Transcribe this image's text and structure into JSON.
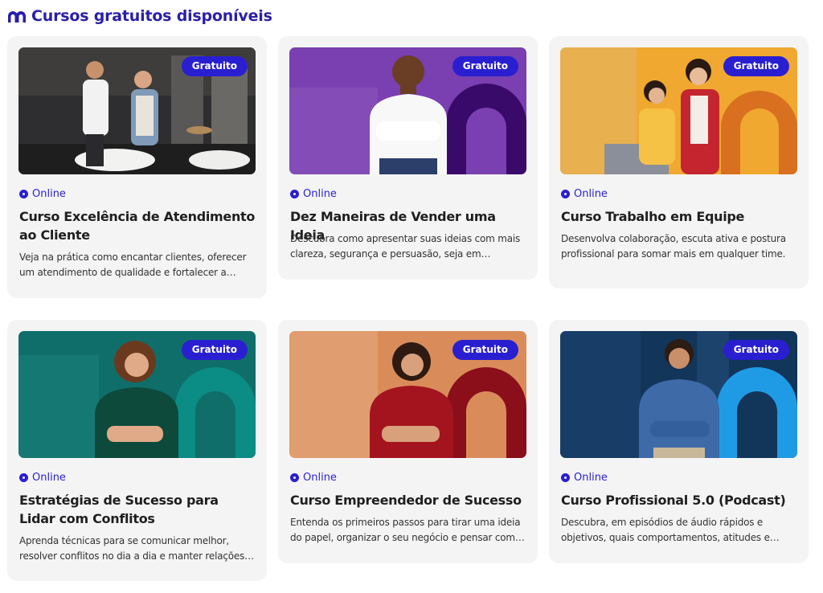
{
  "section": {
    "title": "Cursos gratuitos disponíveis",
    "logo_icon": "brand-arch-icon",
    "accent": "#2a1fd0"
  },
  "cards": [
    {
      "badge": "Gratuito",
      "mode": "Online",
      "title": "Curso Excelência de Atendimento ao Cliente",
      "description": "Veja na prática como encantar clientes, oferecer um atendimento de qualidade e fortalecer a reputação da sua empresa.",
      "image": "photo-store-attendant-and-customer",
      "theme": "#3a3a3a"
    },
    {
      "badge": "Gratuito",
      "mode": "Online",
      "title": "Dez Maneiras de Vender uma Ideia",
      "description": "Descubra como apresentar suas ideias com mais clareza, segurança e persuasão, seja em entrevistas, reuniões ou projetos.",
      "image": "photo-woman-arms-crossed",
      "theme": "#7a3fb0"
    },
    {
      "badge": "Gratuito",
      "mode": "Online",
      "title": "Curso Trabalho em Equipe",
      "description": "Desenvolva colaboração, escuta ativa e postura profissional para somar mais em qualquer time.",
      "image": "photo-women-celebrating",
      "theme": "#f0a830"
    },
    {
      "badge": "Gratuito",
      "mode": "Online",
      "title": "Estratégias de Sucesso para Lidar com Conflitos",
      "description": "Aprenda técnicas para se comunicar melhor, resolver conflitos no dia a dia e manter relações profissionais saudáveis.",
      "image": "photo-smiling-woman-green",
      "theme": "#0f6e6a"
    },
    {
      "badge": "Gratuito",
      "mode": "Online",
      "title": "Curso Empreendedor de Sucesso",
      "description": "Entenda os primeiros passos para tirar uma ideia do papel, organizar o seu negócio e pensar como um empreendedor.",
      "image": "photo-woman-red-blouse",
      "theme": "#d98c5a"
    },
    {
      "badge": "Gratuito",
      "mode": "Online",
      "title": "Curso Profissional 5.0 (Podcast)",
      "description": "Descubra, em episódios de áudio rápidos e objetivos, quais comportamentos, atitudes e habilidades o mercado valoriza.",
      "image": "photo-man-arms-crossed",
      "theme": "#12355a"
    }
  ]
}
